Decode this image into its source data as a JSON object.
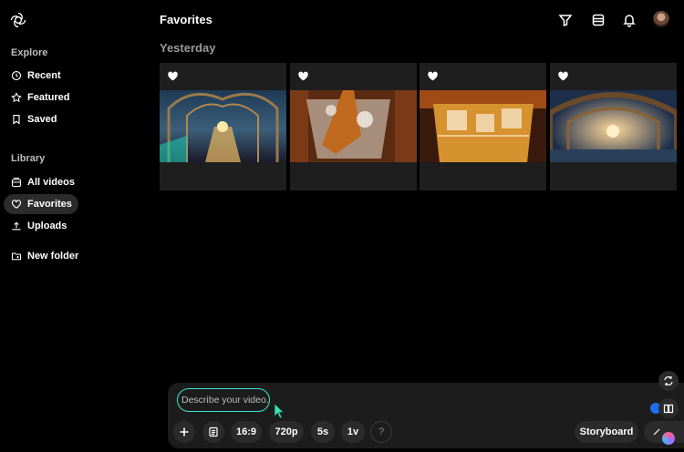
{
  "header": {
    "title": "Favorites"
  },
  "sidebar": {
    "explore_label": "Explore",
    "explore_items": [
      {
        "label": "Recent",
        "icon": "clock-icon"
      },
      {
        "label": "Featured",
        "icon": "star-icon"
      },
      {
        "label": "Saved",
        "icon": "bookmark-icon"
      }
    ],
    "library_label": "Library",
    "library_items": [
      {
        "label": "All videos",
        "icon": "library-icon"
      },
      {
        "label": "Favorites",
        "icon": "heart-icon",
        "active": true
      },
      {
        "label": "Uploads",
        "icon": "upload-icon"
      },
      {
        "label": "New folder",
        "icon": "folder-plus-icon"
      }
    ]
  },
  "main": {
    "group_label": "Yesterday",
    "videos": [
      {
        "favorited": true,
        "thumbnail": "fantasy-hall-with-glowing-crystals"
      },
      {
        "favorited": true,
        "thumbnail": "drink-pouring-into-glass"
      },
      {
        "favorited": true,
        "thumbnail": "iced-drink-close-up"
      },
      {
        "favorited": true,
        "thumbnail": "wooden-arched-hall-sunset"
      }
    ]
  },
  "composer": {
    "placeholder": "Describe your video...",
    "aspect_ratio": "16:9",
    "resolution": "720p",
    "duration": "5s",
    "variations": "1v",
    "help": "?",
    "storyboard_label": "Storyboard"
  },
  "colors": {
    "accent": "#3fe0d0",
    "background": "#000000",
    "surface": "#1c1c1c"
  }
}
